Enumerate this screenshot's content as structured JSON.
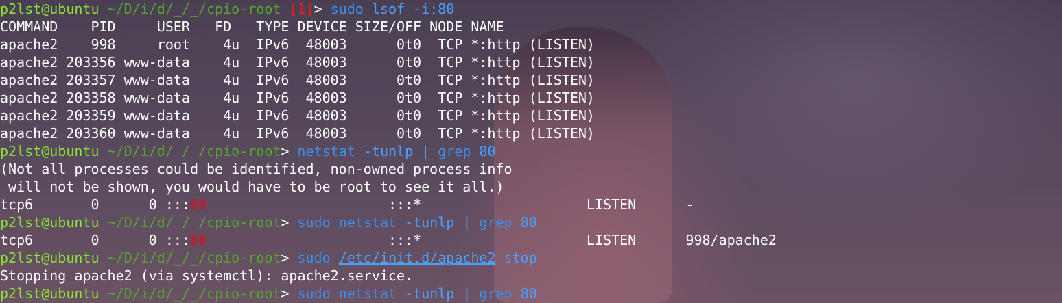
{
  "prompt": {
    "user_host": "p2lst@ubuntu",
    "path": "~/D/i/d/_/_/cpio-root",
    "exit_code": "[1]",
    "symbol": ">"
  },
  "cmd1": {
    "name": "sudo",
    "args": "lsof -i:80"
  },
  "lsof": {
    "header": "COMMAND    PID     USER   FD   TYPE DEVICE SIZE/OFF NODE NAME",
    "rows": [
      "apache2    998     root    4u  IPv6  48003      0t0  TCP *:http (LISTEN)",
      "apache2 203356 www-data    4u  IPv6  48003      0t0  TCP *:http (LISTEN)",
      "apache2 203357 www-data    4u  IPv6  48003      0t0  TCP *:http (LISTEN)",
      "apache2 203358 www-data    4u  IPv6  48003      0t0  TCP *:http (LISTEN)",
      "apache2 203359 www-data    4u  IPv6  48003      0t0  TCP *:http (LISTEN)",
      "apache2 203360 www-data    4u  IPv6  48003      0t0  TCP *:http (LISTEN)"
    ]
  },
  "cmd2": {
    "name": "netstat",
    "args": "-tunlp",
    "pipe": "|",
    "grep": "grep",
    "pattern": "80"
  },
  "netstat_warning": [
    "(Not all processes could be identified, non-owned process info",
    " will not be shown, you would have to be root to see it all.)"
  ],
  "netstat_row1": {
    "pre": "tcp6       0      0 :::",
    "port": "80",
    "post": "                      :::*                    LISTEN      -"
  },
  "cmd3": {
    "sudo": "sudo",
    "name": "netstat",
    "args": "-tunlp",
    "pipe": "|",
    "grep": "grep",
    "pattern": "80"
  },
  "netstat_row2": {
    "pre": "tcp6       0      0 :::",
    "port": "80",
    "post": "                      :::*                    LISTEN      998/apache2"
  },
  "cmd4": {
    "sudo": "sudo",
    "path": "/etc/init.d/apache2",
    "arg": "stop"
  },
  "stop_output": "Stopping apache2 (via systemctl): apache2.service.",
  "cmd5": {
    "sudo": "sudo",
    "name": "netstat",
    "args": "-tunlp",
    "pipe": "|",
    "grep": "grep",
    "pattern": "80"
  }
}
